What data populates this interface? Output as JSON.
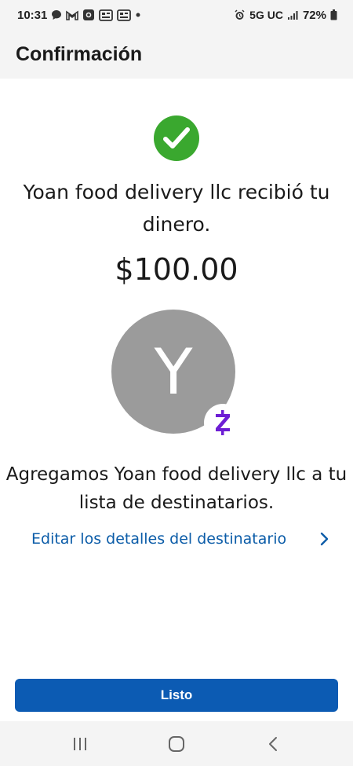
{
  "status_bar": {
    "time": "10:31",
    "network": "5G UC",
    "battery": "72%",
    "left_icons": [
      "chat-icon",
      "gmail-icon",
      "outlook-icon",
      "news-icon",
      "news-icon",
      "dot-icon"
    ],
    "right_icons": [
      "alarm-icon",
      "signal-icon",
      "battery-icon"
    ]
  },
  "header": {
    "title": "Confirmación"
  },
  "confirmation": {
    "message": "Yoan food delivery llc recibió tu dinero.",
    "amount": "$100.00",
    "avatar_initial": "Y",
    "added_message": "Agregamos Yoan food delivery llc a tu lista de destinatarios.",
    "edit_link": "Editar los detalles del destinatario"
  },
  "actions": {
    "done_label": "Listo"
  },
  "colors": {
    "success": "#3aa82f",
    "link": "#0b5ca8",
    "primary_button": "#0c5bb3",
    "zelle": "#6d1ed4",
    "avatar": "#9b9b9b"
  }
}
